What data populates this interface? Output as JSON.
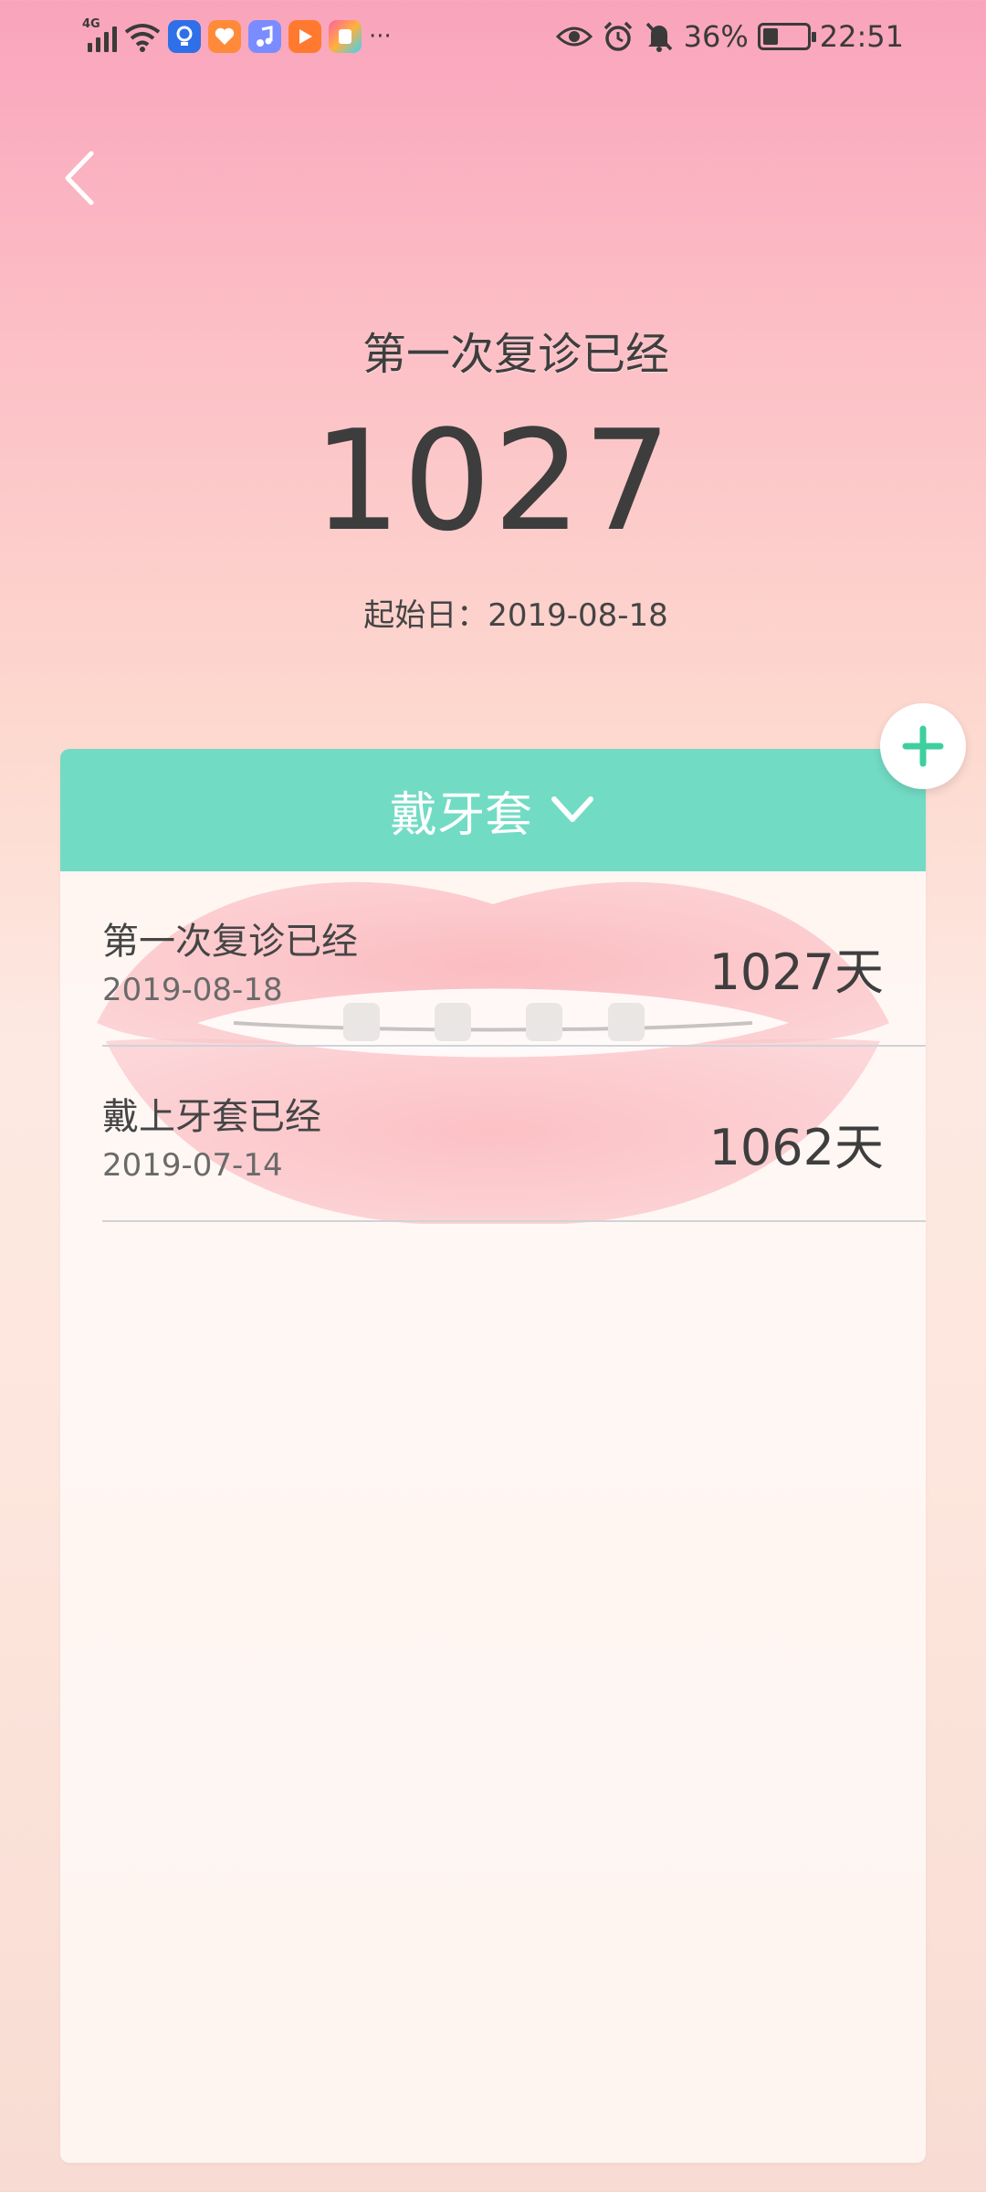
{
  "status_bar": {
    "network_type": "4G",
    "more_indicator": "···",
    "battery_text": "36%",
    "battery_level_percent": 36,
    "time": "22:51",
    "app_icons": [
      "bulb-app-icon",
      "heart-app-icon",
      "music-app-icon",
      "video-app-icon",
      "store-app-icon"
    ]
  },
  "hero": {
    "title": "第一次复诊已经",
    "count": "1027",
    "start_label": "起始日：2019-08-18"
  },
  "card": {
    "category": "戴牙套",
    "items": [
      {
        "title": "第一次复诊已经",
        "date": "2019-08-18",
        "days": "1027天"
      },
      {
        "title": "戴上牙套已经",
        "date": "2019-07-14",
        "days": "1062天"
      }
    ]
  },
  "colors": {
    "accent": "#72dbc4",
    "add_icon": "#3fcf9e",
    "background_top": "#f9a4bc",
    "background_bottom": "#f8dcd3"
  }
}
